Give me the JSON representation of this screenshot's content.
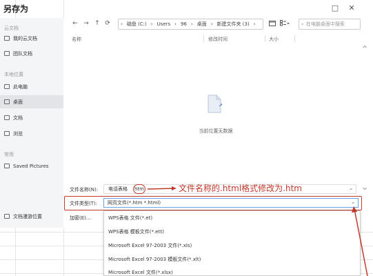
{
  "window": {
    "title": "另存为",
    "controls": [
      "□",
      "✕"
    ]
  },
  "sidebar": {
    "sections": [
      {
        "label": "云文档",
        "items": [
          {
            "label": "我的云文档",
            "icon": "cloud-doc-icon"
          },
          {
            "label": "团队文档",
            "icon": "team-doc-icon"
          }
        ]
      },
      {
        "label": "本地位置",
        "items": [
          {
            "label": "此电脑",
            "icon": "computer-icon"
          },
          {
            "label": "桌面",
            "icon": "desktop-folder-icon",
            "active": true
          },
          {
            "label": "文档",
            "icon": "documents-folder-icon"
          },
          {
            "label": "浏览",
            "icon": "browse-icon"
          }
        ]
      },
      {
        "label": "常用",
        "items": [
          {
            "label": "Saved Pictures",
            "icon": "folder-icon"
          }
        ]
      }
    ],
    "footer": {
      "label": "文档漫游位置",
      "icon": "roaming-icon"
    }
  },
  "toolbar": {
    "back": "←",
    "forward": "→",
    "up": "↑",
    "refresh": "⟳",
    "breadcrumb": [
      "磁盘 (C:)",
      "Users",
      "96",
      "桌面",
      "新建文件夹 (3)"
    ],
    "search_placeholder": "在电脑桌面中搜索"
  },
  "columns": {
    "name": "名称",
    "modified": "修改时间",
    "size": "大小"
  },
  "empty": {
    "message": "当前位置无数据"
  },
  "form": {
    "filename_label": "文件名称(N):",
    "filename_prefix": "电话表格",
    "filename_ext": "htm",
    "filetype_label": "文件类型(T):",
    "filetype_value": "网页文件(*.htm *.html)",
    "encrypt_label": "加密(E)..."
  },
  "dropdown": {
    "options": [
      "WPS表格 文件(*.et)",
      "WPS表格 模板文件(*.ett)",
      "Microsoft Excel 97-2003 文件(*.xls)",
      "Microsoft Excel 97-2003 模板文件(*.xlt)",
      "Microsoft Excel 文件(*.xlsx)"
    ]
  },
  "annotation": {
    "text": "文件名称的.html格式修改为.htm",
    "color": "#c0392b"
  }
}
